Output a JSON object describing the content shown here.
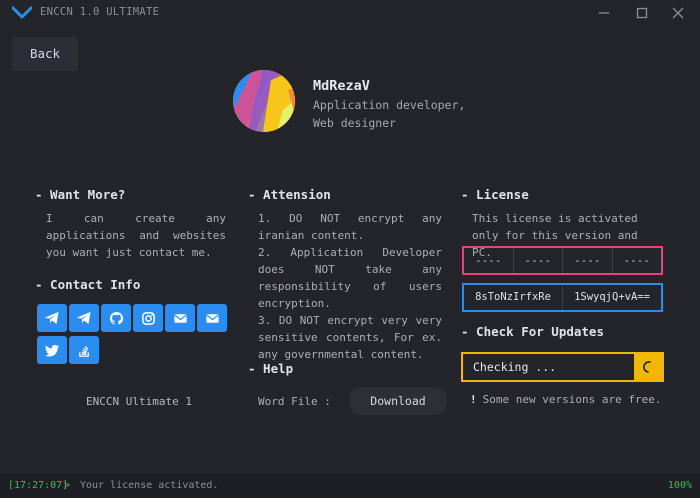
{
  "window": {
    "title": "ENCCN 1.0 ULTIMATE"
  },
  "nav": {
    "back_label": "Back"
  },
  "profile": {
    "name": "MdRezaV",
    "role": "Application developer, Web designer"
  },
  "want_more": {
    "title": "- Want More?",
    "text": "I can create any applications and websites you want just contact me."
  },
  "contact": {
    "title": "- Contact Info",
    "icons": [
      "telegram-icon",
      "telegram-icon",
      "github-icon",
      "instagram-icon",
      "mail-icon",
      "mail-icon",
      "twitter-icon",
      "stackoverflow-icon"
    ]
  },
  "footer_left": {
    "text": "ENCCN Ultimate 1"
  },
  "attention": {
    "title": "- Attension",
    "text": "1. DO NOT encrypt any iranian content.\n2. Application Developer does NOT take any responsibility of users encryption.\n3. DO NOT encrypt very very sensitive contents, For ex. any governmental content."
  },
  "help": {
    "title": "- Help",
    "word_label": "Word File :",
    "download_label": "Download"
  },
  "license": {
    "title": "- License",
    "text": "This license is activated only for this version and PC.",
    "cells": [
      "----",
      "----",
      "----",
      "----"
    ],
    "keys": [
      "8sToNzIrfxRe",
      "1SwyqjQ+vA=="
    ]
  },
  "updates": {
    "title": "- Check For Updates",
    "status": "Checking ...",
    "note_bang": "!",
    "note": "Some new versions are free."
  },
  "status": {
    "time": "[17:27:07]",
    "arrow": ">",
    "message": "Your license activated.",
    "percent": "100%"
  },
  "colors": {
    "accent_blue": "#2c8df0",
    "license_pink": "#e0457b",
    "update_yellow": "#f2b705",
    "status_green": "#3fb950"
  }
}
